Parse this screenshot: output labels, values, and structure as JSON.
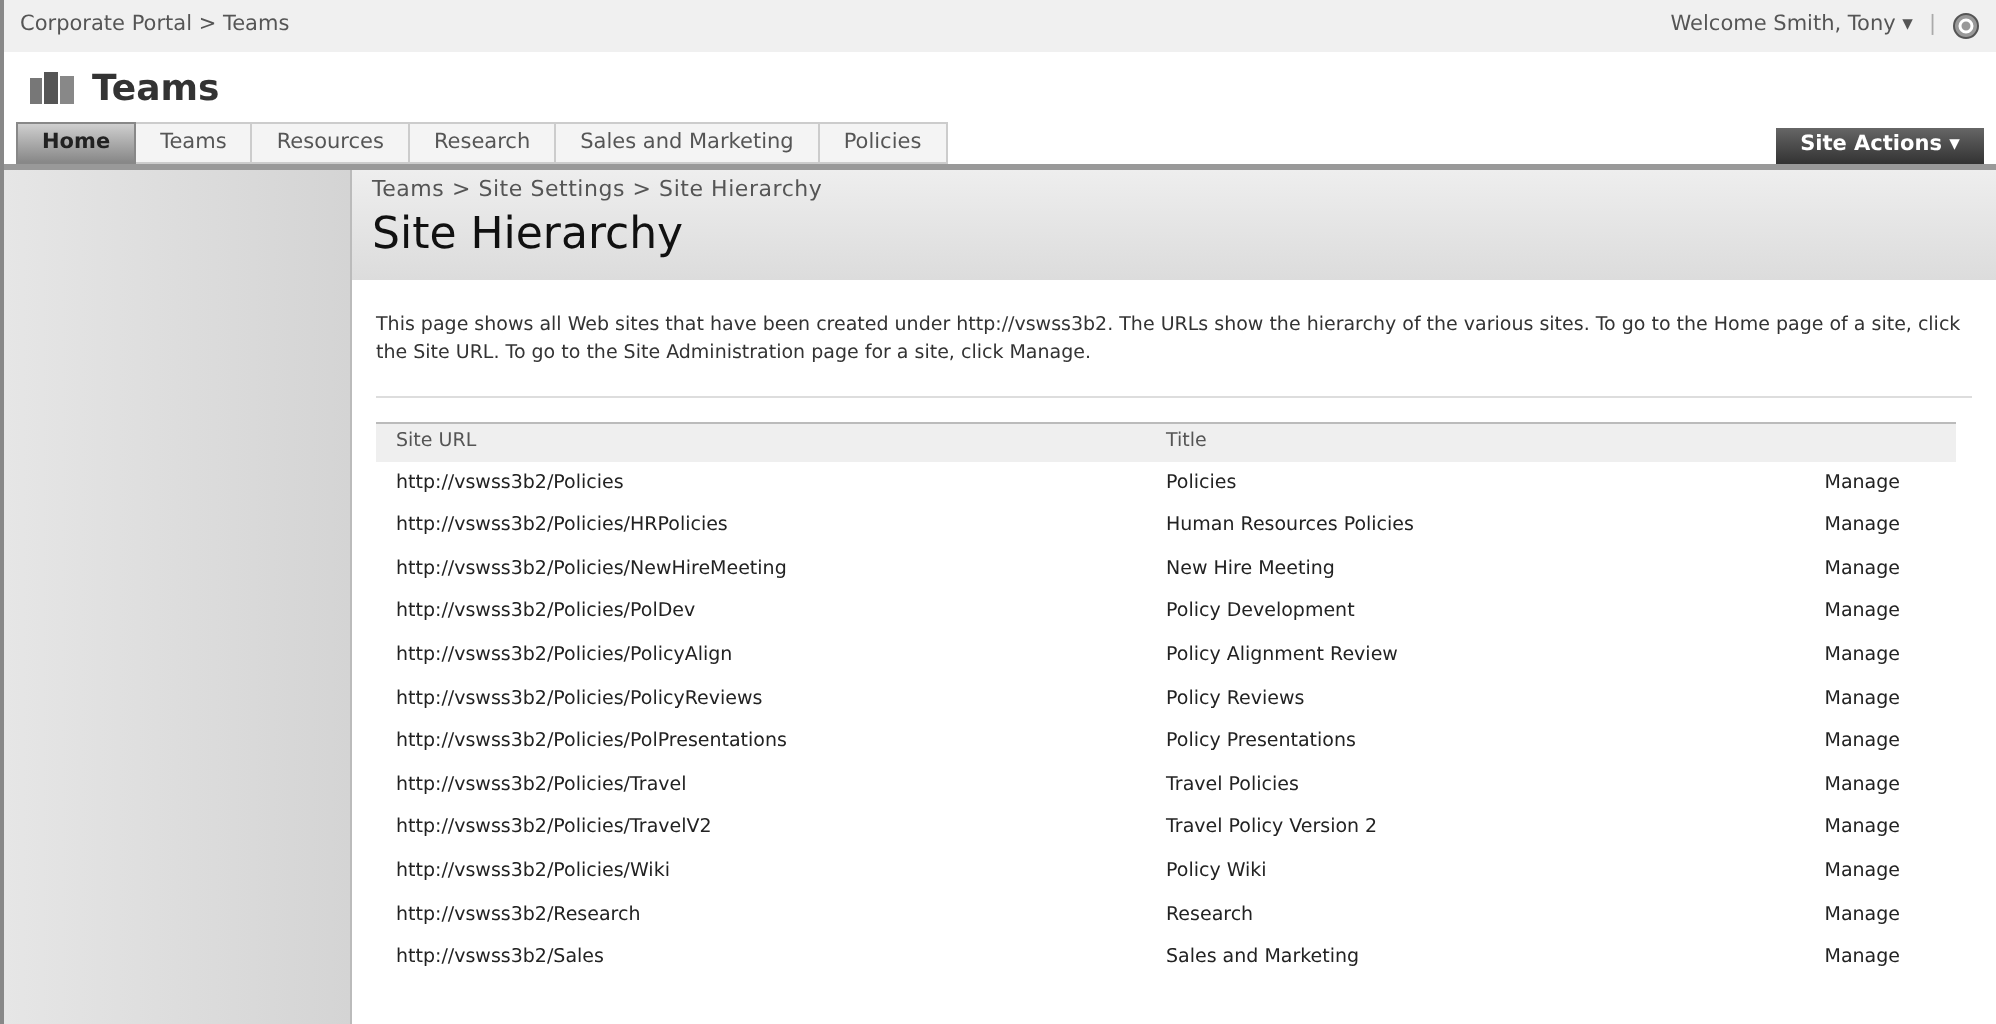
{
  "top_bar": {
    "breadcrumb": "Corporate Portal > Teams",
    "welcome": "Welcome Smith, Tony",
    "welcome_caret": "▾",
    "separator": "|"
  },
  "site": {
    "title": "Teams"
  },
  "tabs": [
    {
      "label": "Home",
      "selected": true
    },
    {
      "label": "Teams",
      "selected": false
    },
    {
      "label": "Resources",
      "selected": false
    },
    {
      "label": "Research",
      "selected": false
    },
    {
      "label": "Sales and Marketing",
      "selected": false
    },
    {
      "label": "Policies",
      "selected": false
    }
  ],
  "site_actions": {
    "label": "Site Actions",
    "caret": "▾"
  },
  "page": {
    "breadcrumb": "Teams > Site Settings > Site Hierarchy",
    "title": "Site Hierarchy",
    "description": "This page shows all Web sites that have been created under http://vswss3b2. The URLs show the hierarchy of the various sites. To go to the Home page of a site, click the Site URL. To go to the Site Administration page for a site, click Manage."
  },
  "table": {
    "columns": [
      "Site URL",
      "Title"
    ],
    "rows": [
      {
        "url": "http://vswss3b2/Policies",
        "title": "Policies",
        "action": "Manage"
      },
      {
        "url": "http://vswss3b2/Policies/HRPolicies",
        "title": "Human Resources Policies",
        "action": "Manage"
      },
      {
        "url": "http://vswss3b2/Policies/NewHireMeeting",
        "title": "New Hire Meeting",
        "action": "Manage"
      },
      {
        "url": "http://vswss3b2/Policies/PolDev",
        "title": "Policy Development",
        "action": "Manage"
      },
      {
        "url": "http://vswss3b2/Policies/PolicyAlign",
        "title": "Policy Alignment Review",
        "action": "Manage"
      },
      {
        "url": "http://vswss3b2/Policies/PolicyReviews",
        "title": "Policy Reviews",
        "action": "Manage"
      },
      {
        "url": "http://vswss3b2/Policies/PolPresentations",
        "title": "Policy Presentations",
        "action": "Manage"
      },
      {
        "url": "http://vswss3b2/Policies/Travel",
        "title": "Travel Policies",
        "action": "Manage"
      },
      {
        "url": "http://vswss3b2/Policies/TravelV2",
        "title": "Travel Policy Version 2",
        "action": "Manage"
      },
      {
        "url": "http://vswss3b2/Policies/Wiki",
        "title": "Policy Wiki",
        "action": "Manage"
      },
      {
        "url": "http://vswss3b2/Research",
        "title": "Research",
        "action": "Manage"
      },
      {
        "url": "http://vswss3b2/Sales",
        "title": "Sales and Marketing",
        "action": "Manage"
      }
    ]
  }
}
